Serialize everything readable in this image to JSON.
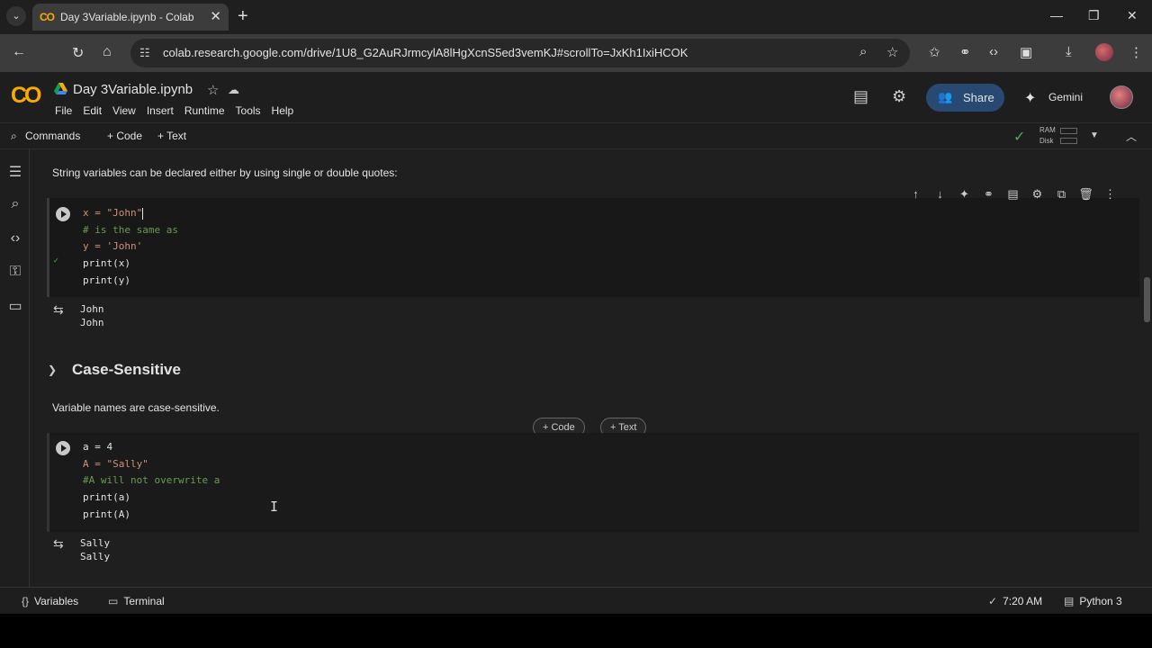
{
  "browser": {
    "tab_title": "Day 3Variable.ipynb - Colab",
    "tab_favicon": "CO",
    "url": "colab.research.google.com/drive/1U8_G2AuRJrmcylA8lHgXcnS5ed3vemKJ#scrollTo=JxKh1IxiHCOK"
  },
  "colab": {
    "logo": "CO",
    "notebook_title": "Day 3Variable.ipynb",
    "menu": [
      "File",
      "Edit",
      "View",
      "Insert",
      "Runtime",
      "Tools",
      "Help"
    ],
    "share_label": "Share",
    "gemini_label": "Gemini"
  },
  "toolbar": {
    "commands_label": "Commands",
    "add_code_label": "+ Code",
    "add_text_label": "+ Text",
    "ram_label": "RAM",
    "disk_label": "Disk"
  },
  "notebook": {
    "md_string_vars": "String variables can be declared either by using single or double quotes:",
    "cell1_lines": [
      {
        "text": "x = \"John\"",
        "kind": "code"
      },
      {
        "text": "# is the same as",
        "kind": "comment"
      },
      {
        "text": "y = 'John'",
        "kind": "code"
      },
      {
        "text": "print(x)",
        "kind": "code"
      },
      {
        "text": "print(y)",
        "kind": "code"
      }
    ],
    "cell1_output": "John\nJohn",
    "section_heading": "Case-Sensitive",
    "md_case_sensitive": "Variable names are case-sensitive.",
    "add_code_btn": "+ Code",
    "add_text_btn": "+ Text",
    "cell2_lines": [
      {
        "text": "a = 4",
        "kind": "code"
      },
      {
        "text": "A = \"Sally\"",
        "kind": "code"
      },
      {
        "text": "#A will not overwrite a",
        "kind": "comment"
      },
      {
        "text": "print(a)",
        "kind": "code"
      },
      {
        "text": "print(A)",
        "kind": "code"
      }
    ],
    "cell2_output": "Sally\nSally"
  },
  "statusbar": {
    "variables_label": "Variables",
    "terminal_label": "Terminal",
    "time": "7:20 AM",
    "kernel": "Python 3"
  },
  "colors": {
    "accent_share": "#284a72",
    "colab_orange": "#f9ab00",
    "comment_green": "#6a9955",
    "connected_green": "#4caf50"
  }
}
